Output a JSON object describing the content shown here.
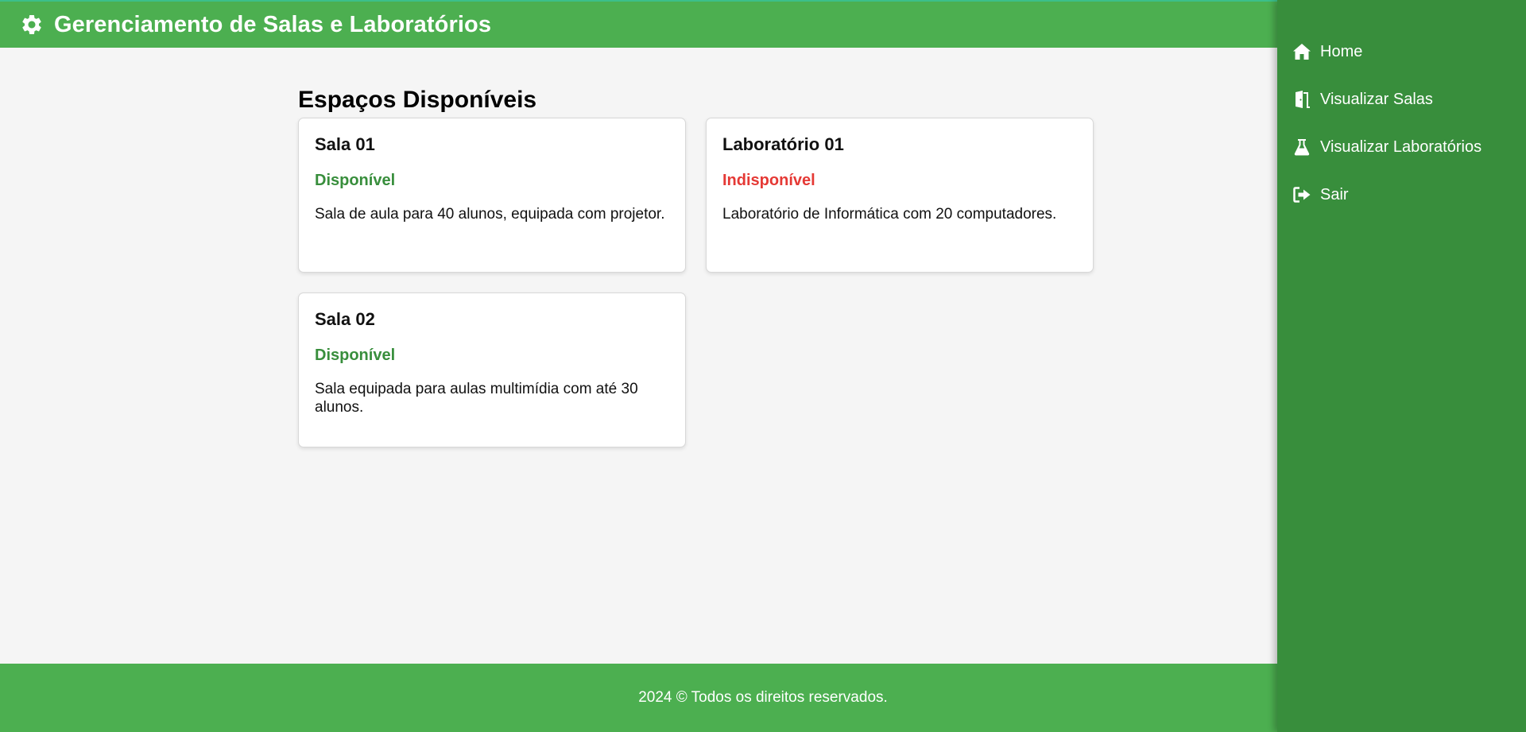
{
  "header": {
    "title": "Gerenciamento de Salas e Laboratórios",
    "icon": "gear-icon"
  },
  "main": {
    "heading": "Espaços Disponíveis",
    "cards": [
      {
        "title": "Sala 01",
        "status": "Disponível",
        "status_color": "#388e3c",
        "description": "Sala de aula para 40 alunos, equipada com projetor."
      },
      {
        "title": "Laboratório 01",
        "status": "Indisponível",
        "status_color": "#e53935",
        "description": "Laboratório de Informática com 20 computadores."
      },
      {
        "title": "Sala 02",
        "status": "Disponível",
        "status_color": "#388e3c",
        "description": "Sala equipada para aulas multimídia com até 30 alunos."
      }
    ]
  },
  "sidebar": {
    "items": [
      {
        "label": "Home",
        "icon": "home-icon"
      },
      {
        "label": "Visualizar Salas",
        "icon": "door-icon"
      },
      {
        "label": "Visualizar Laboratórios",
        "icon": "flask-icon"
      },
      {
        "label": "Sair",
        "icon": "logout-icon"
      }
    ]
  },
  "footer": {
    "text": "2024 © Todos os direitos reservados."
  },
  "colors": {
    "primary": "#4caf50",
    "sidebar": "#388e3c",
    "available": "#388e3c",
    "unavailable": "#e53935"
  }
}
